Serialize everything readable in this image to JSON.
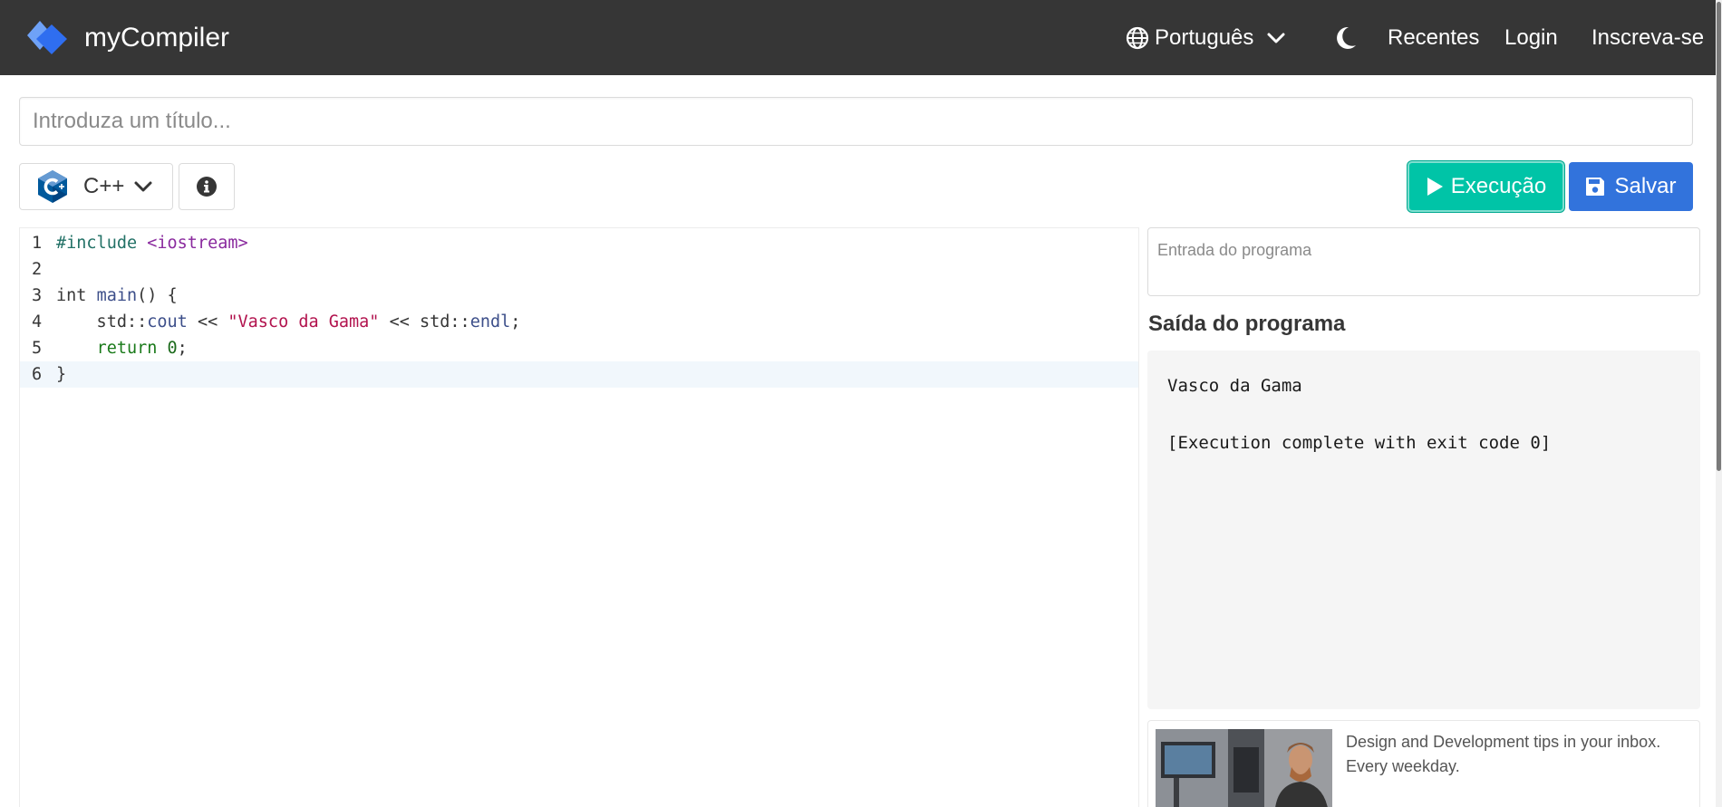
{
  "navbar": {
    "brand": "myCompiler",
    "language": "Português",
    "links": [
      "Recentes",
      "Login",
      "Inscreva-se"
    ],
    "colors": {
      "background": "#363636",
      "logo": "#3d7cf0"
    }
  },
  "editor_form": {
    "title_placeholder": "Introduza um título...",
    "language_label": "C++",
    "run_label": "Execução",
    "save_label": "Salvar",
    "colors": {
      "run": "#00c4a7",
      "save": "#3273dc"
    }
  },
  "code": {
    "line_numbers": [
      "1",
      "2",
      "3",
      "4",
      "5",
      "6"
    ],
    "lines": [
      [
        {
          "t": "#include",
          "c": "tk-dir"
        },
        {
          "t": " ",
          "c": ""
        },
        {
          "t": "<iostream>",
          "c": "tk-inc"
        }
      ],
      [],
      [
        {
          "t": "int",
          "c": "tk-kw"
        },
        {
          "t": " ",
          "c": ""
        },
        {
          "t": "main",
          "c": "tk-fn"
        },
        {
          "t": "() {",
          "c": ""
        }
      ],
      [
        {
          "t": "    std::",
          "c": ""
        },
        {
          "t": "cout",
          "c": "tk-fn"
        },
        {
          "t": " << ",
          "c": ""
        },
        {
          "t": "\"Vasco da Gama\"",
          "c": "tk-str"
        },
        {
          "t": " << std::",
          "c": ""
        },
        {
          "t": "endl",
          "c": "tk-fn"
        },
        {
          "t": ";",
          "c": ""
        }
      ],
      [
        {
          "t": "    ",
          "c": ""
        },
        {
          "t": "return",
          "c": "tk-ret"
        },
        {
          "t": " ",
          "c": ""
        },
        {
          "t": "0",
          "c": "tk-num"
        },
        {
          "t": ";",
          "c": ""
        }
      ],
      [
        {
          "t": "}",
          "c": ""
        }
      ]
    ],
    "active_line": 6
  },
  "io": {
    "input_placeholder": "Entrada do programa",
    "output_title": "Saída do programa",
    "output_line_1": "Vasco da Gama",
    "output_line_2": "[Execution complete with exit code 0]"
  },
  "ad": {
    "text": "Design and Development tips in your inbox. Every weekday."
  }
}
